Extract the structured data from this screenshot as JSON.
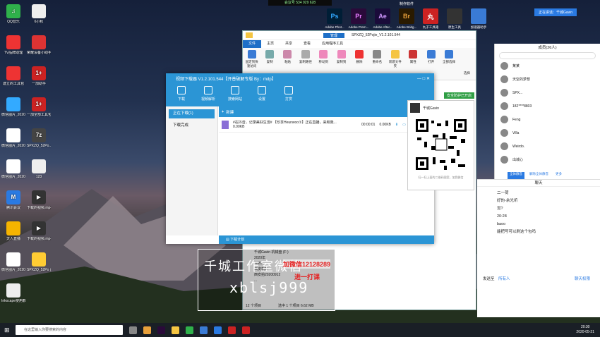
{
  "top_status": "会议号 534 929 628",
  "desktop_icons": [
    {
      "label": "QQ音乐",
      "color": "#2fb14b",
      "glyph": "♫"
    },
    {
      "label": "6小秋",
      "color": "#eee",
      "glyph": ""
    },
    {
      "label": "TV品牌助理",
      "color": "#e33",
      "glyph": ""
    },
    {
      "label": "荣耀设备小助手",
      "color": "#d33",
      "glyph": ""
    },
    {
      "label": "建立的工具包",
      "color": "#e33",
      "glyph": ""
    },
    {
      "label": "一加助手",
      "color": "#c22",
      "glyph": "1+"
    },
    {
      "label": "微信图片_20200519224...",
      "color": "#3af",
      "glyph": ""
    },
    {
      "label": "一加全部工具包",
      "color": "#c22",
      "glyph": "1+"
    },
    {
      "label": "微信图片_20200519224...",
      "color": "#fff",
      "glyph": ""
    },
    {
      "label": "SPXZQ_52Po...",
      "color": "#444",
      "glyph": "7z"
    },
    {
      "label": "微信图片_202005212...",
      "color": "#fff",
      "glyph": ""
    },
    {
      "label": "123",
      "color": "#eee",
      "glyph": ""
    },
    {
      "label": "腾讯会议",
      "color": "#2a7ae2",
      "glyph": "M"
    },
    {
      "label": "下载的视频.mp4",
      "color": "#333",
      "glyph": "▶"
    },
    {
      "label": "天人直播",
      "color": "#f5b400",
      "glyph": ""
    },
    {
      "label": "下载的视频.mp4",
      "color": "#333",
      "glyph": "▶"
    },
    {
      "label": "微信图片_20200519...",
      "color": "#fff",
      "glyph": ""
    },
    {
      "label": "SPXZQ_52Po jie_V1.2.101...",
      "color": "#ffcc33",
      "glyph": ""
    },
    {
      "label": "Inkscape使用教程",
      "color": "#eee",
      "glyph": ""
    }
  ],
  "adobe_apps": [
    {
      "abbr": "Ps",
      "label": "Adobe Phot...",
      "bg": "#001e36",
      "fg": "#31a8ff"
    },
    {
      "abbr": "Pr",
      "label": "Adobe Prem...",
      "bg": "#2a0a3a",
      "fg": "#e77bff"
    },
    {
      "abbr": "Ae",
      "label": "Adobe After...",
      "bg": "#1a0b3a",
      "fg": "#cf96fd"
    },
    {
      "abbr": "Br",
      "label": "Adobe Bridg...",
      "bg": "#2a1a00",
      "fg": "#e8a03b"
    },
    {
      "abbr": "丸",
      "label": "丸子工具箱",
      "bg": "#c22",
      "fg": "#fff"
    },
    {
      "abbr": "",
      "label": "原生工具",
      "bg": "#333",
      "fg": "#fff"
    },
    {
      "abbr": "",
      "label": "加速器助手",
      "bg": "#3a7bd5",
      "fg": "#fff"
    }
  ],
  "folder_label": "制作软件",
  "explorer": {
    "title": "SPXZQ_52Pojie_V1.2.101.544",
    "manage_tab": "管理",
    "tabs": [
      "文件",
      "主页",
      "共享",
      "查看",
      "应用程序工具"
    ],
    "ribbon": [
      {
        "label": "固定到快速访问",
        "color": "#3a7bd5"
      },
      {
        "label": "复制",
        "color": "#7aa"
      },
      {
        "label": "粘贴",
        "color": "#c8a"
      },
      {
        "label": "复制路径",
        "color": "#aaa"
      },
      {
        "label": "移动到",
        "color": "#e8b"
      },
      {
        "label": "复制到",
        "color": "#e8b"
      },
      {
        "label": "删除",
        "color": "#e33"
      },
      {
        "label": "重命名",
        "color": "#888"
      },
      {
        "label": "新建文件夹",
        "color": "#f5c542"
      },
      {
        "label": "属性",
        "color": "#c33"
      },
      {
        "label": "打开",
        "color": "#3a7bd5"
      },
      {
        "label": "全部选择",
        "color": "#3a7bd5"
      }
    ],
    "sections": [
      "选择"
    ],
    "security": "安全防护已开启",
    "folders": [
      "千城Gavin 机械盘 (F:)",
      "2020年",
      "2020...",
      "西安机械",
      "西安拍20200912",
      "..."
    ],
    "status_left": "12 个项目",
    "status_right": "选中 1 个项目  6.62 MB"
  },
  "downloader": {
    "title": "视频下载器 V1.2.101.544【开普破解专版 By：mdp】",
    "tools": [
      "下载",
      "视频解析",
      "搜索网站",
      "设置",
      "打赏"
    ],
    "side": [
      "正在下载(1)",
      "下载完成"
    ],
    "new_label": "新建",
    "row_title": "#在抖音，记录美好生活# 【珍享Heunwoo①】正在直播，来和我...",
    "row_size": "0.00KB",
    "row_time": "00:00:01",
    "row_speed": "0.00KB",
    "footer": "下载计划"
  },
  "qr": {
    "name": "千城Gavin",
    "caption": "扫一扫上面的二维码图案，加我微信"
  },
  "chat": {
    "top_label": "成员(26人)",
    "search_placeholder": "",
    "members": [
      "某某",
      "天空的梦想",
      "SPX...",
      "182****8803",
      "Feng",
      "Villa",
      "Weirdo.",
      "出城心"
    ],
    "tabs": [
      "全体静音",
      "解除全体静音",
      "更多"
    ],
    "chat_title": "聊天",
    "messages": [
      "二一荷",
      "好的-余光圻",
      "没?",
      "20:28",
      "baoo",
      "能把号可以刷这个包吗"
    ],
    "send_to_label": "发送至",
    "send_to": "所有人",
    "perm": "聊天权限"
  },
  "meeting_badge": "正在讲话：千城Gavin",
  "watermark": {
    "line1": "千城工作室微信",
    "line2": "xblsj999",
    "red1": "加微信12128289",
    "red2": "进一打课"
  },
  "taskbar": {
    "search_placeholder": "在这里输入你要搜索的内容",
    "time": "20:30",
    "date": "2020-05-21"
  }
}
